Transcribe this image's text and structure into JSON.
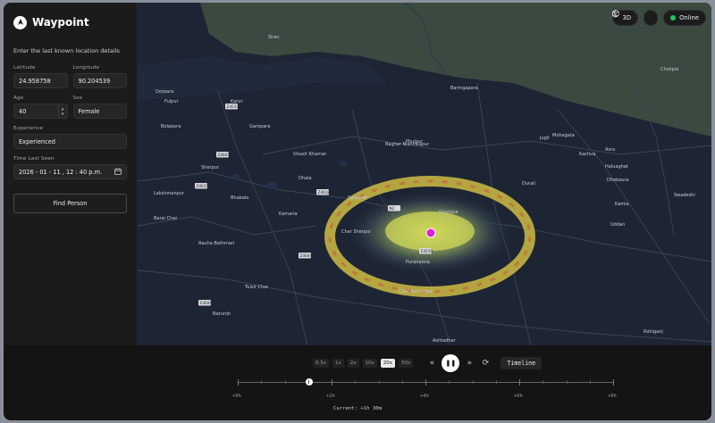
{
  "app": {
    "title": "Waypoint"
  },
  "form": {
    "intro": "Enter the last known location details",
    "latitude": {
      "label": "Latitude",
      "value": "24.958758"
    },
    "longitude": {
      "label": "Longitude",
      "value": "90.204539"
    },
    "age": {
      "label": "Age",
      "value": "40"
    },
    "sex": {
      "label": "Sex",
      "value": "Female"
    },
    "experience": {
      "label": "Experience",
      "value": "Experienced"
    },
    "time_last_seen": {
      "label": "Time Last Seen",
      "value": "2026 - 01 - 11 ,  12 : 40   p.m."
    },
    "find_button": "Find Person"
  },
  "map_controls": {
    "view_3d": "3D",
    "status": "Online"
  },
  "map_labels": [
    "Shan",
    "Chokpoi",
    "Baringapara",
    "Haluaghat",
    "Dorpara",
    "Fulpur",
    "Karur",
    "Garopara",
    "Phulpur",
    "Sherpur",
    "Dhala",
    "Gouripur",
    "Durail",
    "Saraipdir",
    "Kamaria",
    "Barai Char",
    "Rauha Bethmari",
    "Tulsir Char",
    "Narundi",
    "Char Ashrafpur",
    "Ashtadhar",
    "Rahiganj",
    "Lakshmanpur",
    "Bhabala",
    "Purahatola",
    "Char Sherpur",
    "Mohagata",
    "Ghazir Khamar",
    "Bagher Nishinkapur",
    "Kachua",
    "Asra",
    "Kamla",
    "Dhobaura",
    "Uddan",
    "Swadeshi",
    "Jugli",
    "Bolaoura"
  ],
  "map_route_labels": [
    "Z4037",
    "Z4601",
    "Z4615",
    "Z4618",
    "Z4604",
    "Z4010",
    "Z4606",
    "N2"
  ],
  "playback": {
    "speeds": [
      "0.5x",
      "1x",
      "2x",
      "10x",
      "20x",
      "50x"
    ],
    "active_speed": "20x",
    "timeline_button": "Timeline",
    "ticks": [
      "+0h",
      "+2h",
      "+4h",
      "+6h",
      "+8h"
    ],
    "current": "Current: +1h 30m",
    "progress": 0.19
  },
  "colors": {
    "accent_online": "#22c55e",
    "marker": "#e11bd6"
  }
}
